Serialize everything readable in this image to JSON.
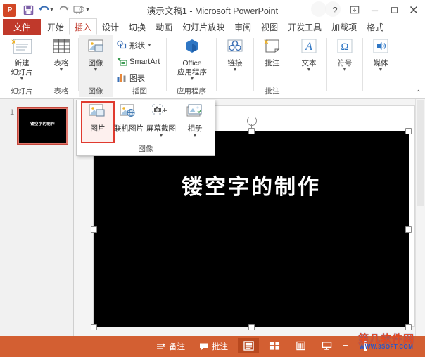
{
  "titlebar": {
    "app_icon": "powerpoint-logo",
    "title": "演示文稿1 - Microsoft PowerPoint",
    "quick_access": [
      {
        "name": "save",
        "icon": "floppy-disk-icon"
      },
      {
        "name": "undo",
        "icon": "undo-arrow-icon"
      },
      {
        "name": "redo",
        "icon": "redo-arrow-icon"
      },
      {
        "name": "start-slideshow",
        "icon": "slideshow-icon"
      },
      {
        "name": "customize-quick-access",
        "icon": "chevron-down-icon"
      }
    ],
    "help_label": "?",
    "ribbon_display_label": "▣",
    "minimize_label": "—",
    "maximize_label": "❐",
    "close_label": "✕"
  },
  "tabs": {
    "file_label": "文件",
    "items": [
      {
        "label": "开始",
        "active": false
      },
      {
        "label": "插入",
        "active": true
      },
      {
        "label": "设计",
        "active": false
      },
      {
        "label": "切换",
        "active": false
      },
      {
        "label": "动画",
        "active": false
      },
      {
        "label": "幻灯片放映",
        "active": false
      },
      {
        "label": "审阅",
        "active": false
      },
      {
        "label": "视图",
        "active": false
      },
      {
        "label": "开发工具",
        "active": false
      },
      {
        "label": "加载项",
        "active": false
      },
      {
        "label": "格式",
        "active": false
      }
    ]
  },
  "ribbon": {
    "groups": [
      {
        "name": "slides",
        "label": "幻灯片"
      },
      {
        "name": "tables",
        "label": "表格"
      },
      {
        "name": "images",
        "label": "图像"
      },
      {
        "name": "illustrations",
        "label": "插图"
      },
      {
        "name": "apps",
        "label": "应用程序"
      },
      {
        "name": "links",
        "label": "链接"
      },
      {
        "name": "comments",
        "label": "批注"
      },
      {
        "name": "text",
        "label": "文本"
      },
      {
        "name": "symbols",
        "label": "符号"
      },
      {
        "name": "media",
        "label": "媒体"
      }
    ],
    "new_slide_label_1": "新建",
    "new_slide_label_2": "幻灯片",
    "table_label": "表格",
    "image_label": "图像",
    "shapes_label": "形状",
    "smartart_label": "SmartArt",
    "chart_label": "图表",
    "office_apps_label_1": "Office",
    "office_apps_label_2": "应用程序",
    "link_label": "链接",
    "comment_label": "批注",
    "text_label": "文本",
    "symbol_label": "符号",
    "media_label": "媒体",
    "collapse_label": "⌃"
  },
  "image_dropdown": {
    "group_label": "图像",
    "items": [
      {
        "label": "图片",
        "icon": "picture-icon",
        "selected": true
      },
      {
        "label": "联机图片",
        "icon": "online-picture-icon",
        "selected": false
      },
      {
        "label": "屏幕截图",
        "icon": "screenshot-camera-icon",
        "selected": false
      },
      {
        "label": "相册",
        "icon": "photo-album-icon",
        "selected": false
      }
    ]
  },
  "thumbnail_pane": {
    "slide_number": "1",
    "slide_text": "镂空字的制作"
  },
  "slide": {
    "shape_text": "镂空字的制作",
    "shape_fill": "#000000"
  },
  "status_bar": {
    "notes_label": "备注",
    "comments_label": "批注",
    "views": [
      {
        "name": "normal-view",
        "icon": "normal-view-icon",
        "active": true
      },
      {
        "name": "slide-sorter-view",
        "icon": "slide-sorter-icon",
        "active": false
      },
      {
        "name": "reading-view",
        "icon": "reading-view-icon",
        "active": false
      },
      {
        "name": "slideshow-view",
        "icon": "slideshow-view-icon",
        "active": false
      }
    ],
    "zoom_out_label": "−",
    "watermark_line1": "第几软件网",
    "watermark_line2": "WWW.3SOFT.COM"
  }
}
